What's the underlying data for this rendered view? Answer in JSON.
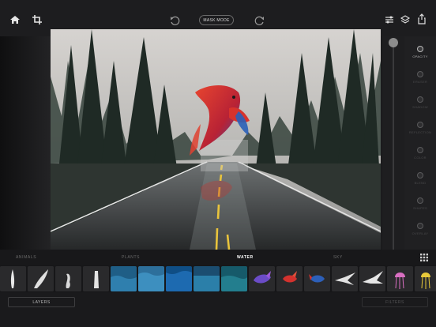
{
  "toolbar": {
    "mask_mode_label": "MASK MODE",
    "left_icons": [
      "home-icon",
      "crop-icon"
    ],
    "history_icons": [
      "undo-icon",
      "redo-icon"
    ],
    "right_icons": [
      "adjust-icon",
      "layers-stack-icon",
      "share-icon"
    ]
  },
  "opacity_slider": {
    "value": 1.0
  },
  "tools": [
    {
      "label": "OPACITY",
      "active": true
    },
    {
      "label": "ERASER",
      "active": false
    },
    {
      "label": "SHADOW",
      "active": false
    },
    {
      "label": "REFLECTION",
      "active": false
    },
    {
      "label": "COLOR",
      "active": false
    },
    {
      "label": "BLEND",
      "active": false
    },
    {
      "label": "SHAPES",
      "active": false
    },
    {
      "label": "OVERLAY",
      "active": false
    }
  ],
  "categories": [
    {
      "label": "ANIMALS",
      "active": false
    },
    {
      "label": "PLANTS",
      "active": false
    },
    {
      "label": "WATER",
      "active": true
    },
    {
      "label": "SKY",
      "active": false
    }
  ],
  "thumbnails": [
    "splash",
    "splash",
    "splash",
    "splash",
    "water-surface",
    "water-surface",
    "water-surface",
    "water-surface",
    "water-surface",
    "fish",
    "fish",
    "fish",
    "bird",
    "bird",
    "jellyfish",
    "jellyfish"
  ],
  "bottom": {
    "layers_label": "LAYERS",
    "filters_label": "FILTERS"
  },
  "colors": {
    "accent": "#ffffff",
    "fish": "#d83a2a",
    "road_line": "#e9c43c",
    "fish_fin": "#2a5fb8"
  }
}
